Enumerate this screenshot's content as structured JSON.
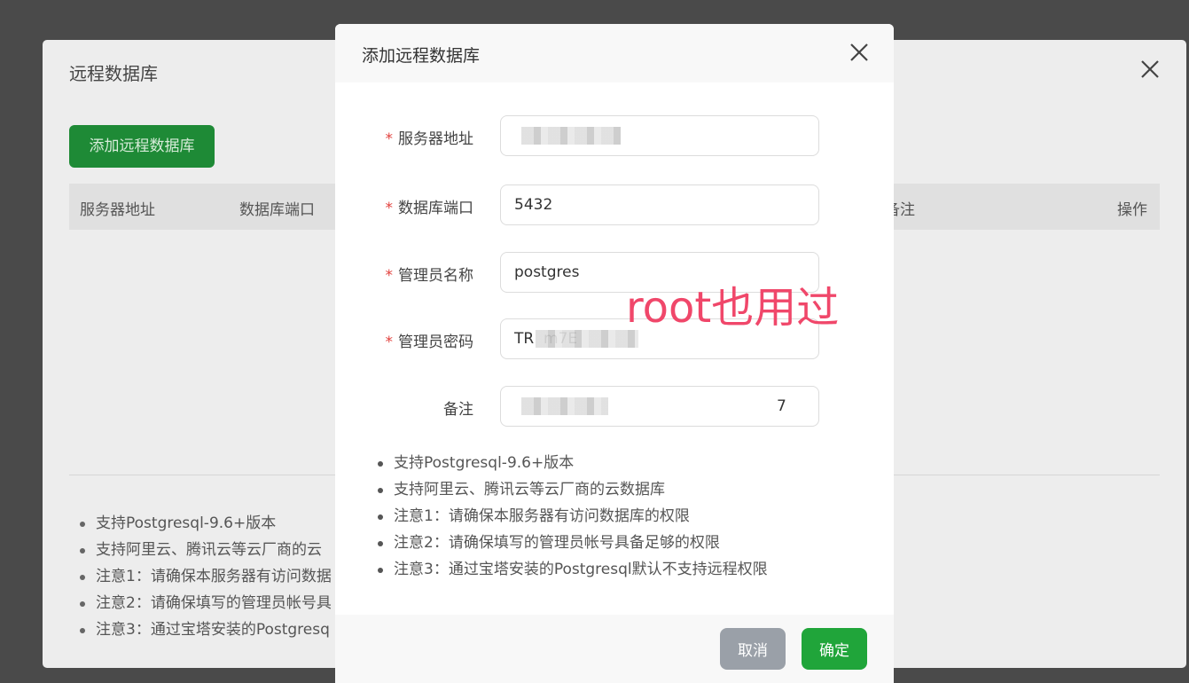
{
  "back_dialog": {
    "title": "远程数据库",
    "add_button": "添加远程数据库",
    "columns": [
      "服务器地址",
      "数据库端口",
      "备注",
      "操作"
    ],
    "notes": [
      "支持Postgresql-9.6+版本",
      "支持阿里云、腾讯云等云厂商的云",
      "注意1：请确保本服务器有访问数据",
      "注意2：请确保填写的管理员帐号具",
      "注意3：通过宝塔安装的Postgresq"
    ]
  },
  "modal": {
    "title": "添加远程数据库",
    "fields": {
      "server": {
        "label": "服务器地址",
        "value": ""
      },
      "port": {
        "label": "数据库端口",
        "value": "5432"
      },
      "admin_name": {
        "label": "管理员名称",
        "value": "postgres"
      },
      "admin_password": {
        "label": "管理员密码",
        "value": "TR  m7E"
      },
      "remark": {
        "label": "备注",
        "value": "7"
      }
    },
    "required_mark": "*",
    "annotation": "root也用过",
    "notes": [
      "支持Postgresql-9.6+版本",
      "支持阿里云、腾讯云等云厂商的云数据库",
      "注意1：请确保本服务器有访问数据库的权限",
      "注意2：请确保填写的管理员帐号具备足够的权限",
      "注意3：通过宝塔安装的Postgresql默认不支持远程权限"
    ],
    "buttons": {
      "cancel": "取消",
      "confirm": "确定"
    }
  },
  "colors": {
    "accent": "#20a53a",
    "required": "#e2413d",
    "annotation": "#f0476a"
  }
}
